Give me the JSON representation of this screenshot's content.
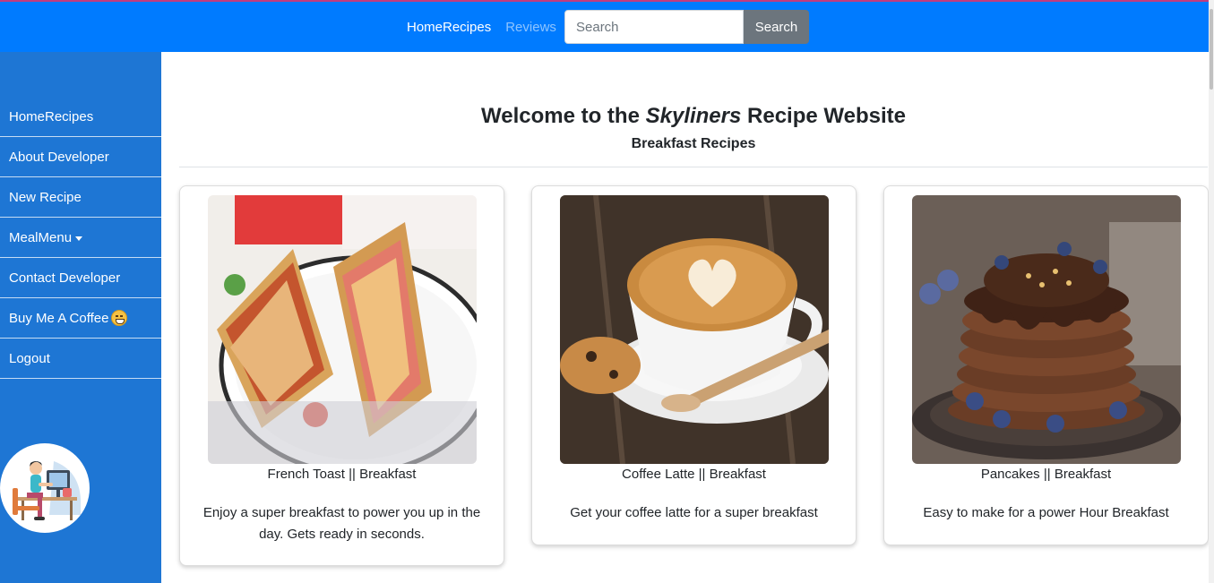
{
  "topnav": {
    "home_recipes": "HomeRecipes",
    "reviews": "Reviews",
    "search_placeholder": "Search",
    "search_button": "Search"
  },
  "sidebar": {
    "items": [
      {
        "label": "HomeRecipes"
      },
      {
        "label": "About Developer"
      },
      {
        "label": "New Recipe"
      },
      {
        "label": "MealMenu"
      },
      {
        "label": "Contact Developer"
      },
      {
        "label": "Buy Me A Coffee"
      },
      {
        "label": "Logout"
      }
    ]
  },
  "main": {
    "title_prefix": "Welcome to the ",
    "title_emphasis": "Skyliners",
    "title_suffix": " Recipe Website",
    "subtitle": "Breakfast Recipes",
    "cards": [
      {
        "title": "French Toast || Breakfast",
        "description": "Enjoy a super breakfast to power you up in the day. Gets ready in seconds.",
        "image": "sandwich-photo"
      },
      {
        "title": "Coffee Latte || Breakfast",
        "description": "Get your coffee latte for a super breakfast",
        "image": "coffee-latte-photo"
      },
      {
        "title": "Pancakes || Breakfast",
        "description": "Easy to make for a power Hour Breakfast",
        "image": "pancakes-photo"
      }
    ]
  },
  "colors": {
    "topbar": "#007bff",
    "sidebar": "#1e76d4",
    "search_button": "#6c757d"
  }
}
